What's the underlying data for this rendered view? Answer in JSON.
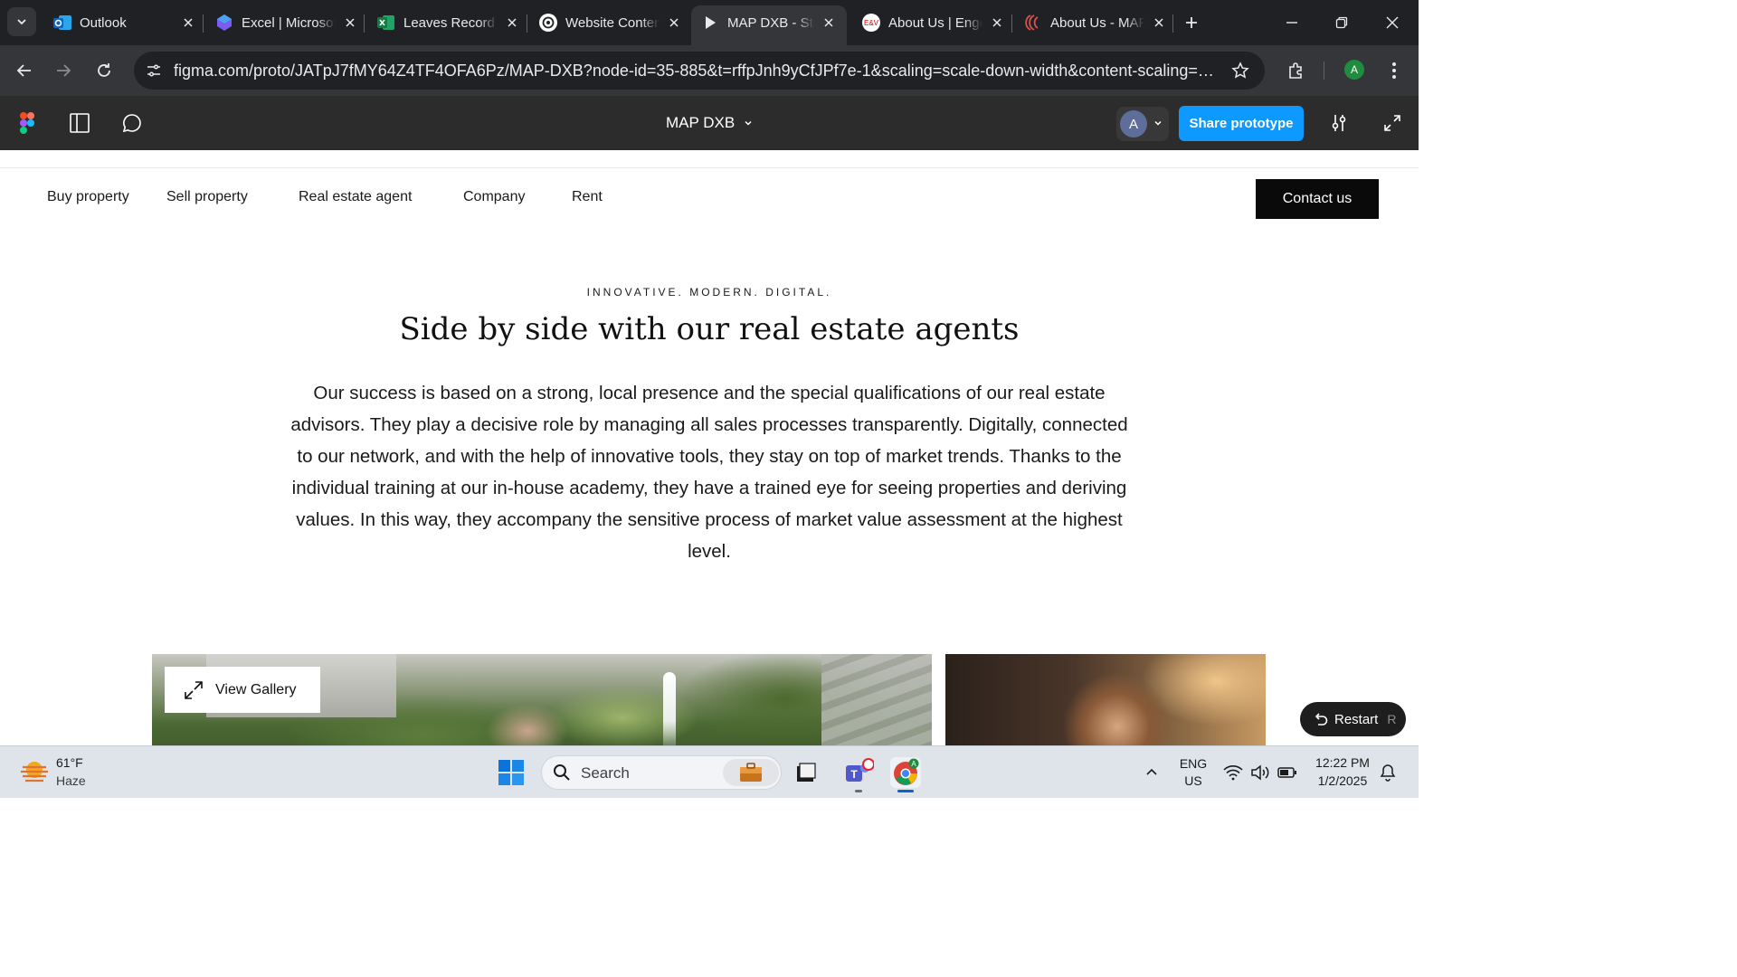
{
  "browser": {
    "tabs": [
      {
        "title": "Outlook",
        "icon": "outlook-icon",
        "active": false
      },
      {
        "title": "Excel | Microsoft",
        "icon": "excel-copilot-icon",
        "active": false
      },
      {
        "title": "Leaves Record",
        "icon": "excel-icon",
        "active": false
      },
      {
        "title": "Website Content",
        "icon": "chatgpt-icon",
        "active": false
      },
      {
        "title": "MAP DXB - Start",
        "icon": "figma-play-icon",
        "active": true
      },
      {
        "title": "About Us | Engel",
        "icon": "ev-icon",
        "active": false
      },
      {
        "title": "About Us - MAP",
        "icon": "map-logo-icon",
        "active": false
      }
    ],
    "url": "figma.com/proto/JATpJ7fMY64Z4TF4OFA6Pz/MAP-DXB?node-id=35-885&t=rffpJnh9yCfJPf7e-1&scaling=scale-down-width&content-scaling=fixed&p...",
    "profile_initial": "A"
  },
  "figma": {
    "file_name": "MAP DXB",
    "avatar_initial": "A",
    "share_label": "Share prototype"
  },
  "site": {
    "nav": [
      {
        "label": "Buy property"
      },
      {
        "label": "Sell property"
      },
      {
        "label": "Real estate agent"
      },
      {
        "label": "Company"
      },
      {
        "label": "Rent"
      }
    ],
    "contact_label": "Contact us",
    "kicker": "INNOVATIVE. MODERN. DIGITAL.",
    "heading": "Side by side with our real estate agents",
    "body": "Our success is based on a strong, local presence and the special qualifications of our real estate advisors. They play a decisive role by managing all sales processes transparently. Digitally, connected to our network, and with the help of innovative tools, they stay on top of market trends. Thanks to the individual training at our in-house academy, they have a trained eye for seeing properties and deriving values. In this way, they accompany the sensitive process of market value assessment at the highest level.",
    "gallery_label": "View Gallery"
  },
  "prototype": {
    "restart_label": "Restart",
    "restart_key": "R"
  },
  "taskbar": {
    "weather_temp": "61°F",
    "weather_cond": "Haze",
    "search_label": "Search",
    "lang_line1": "ENG",
    "lang_line2": "US",
    "time": "12:22 PM",
    "date": "1/2/2025"
  },
  "colors": {
    "figma_blue": "#0d99ff",
    "contact_bg": "#0a0a0a",
    "chrome_dark": "#202124"
  }
}
